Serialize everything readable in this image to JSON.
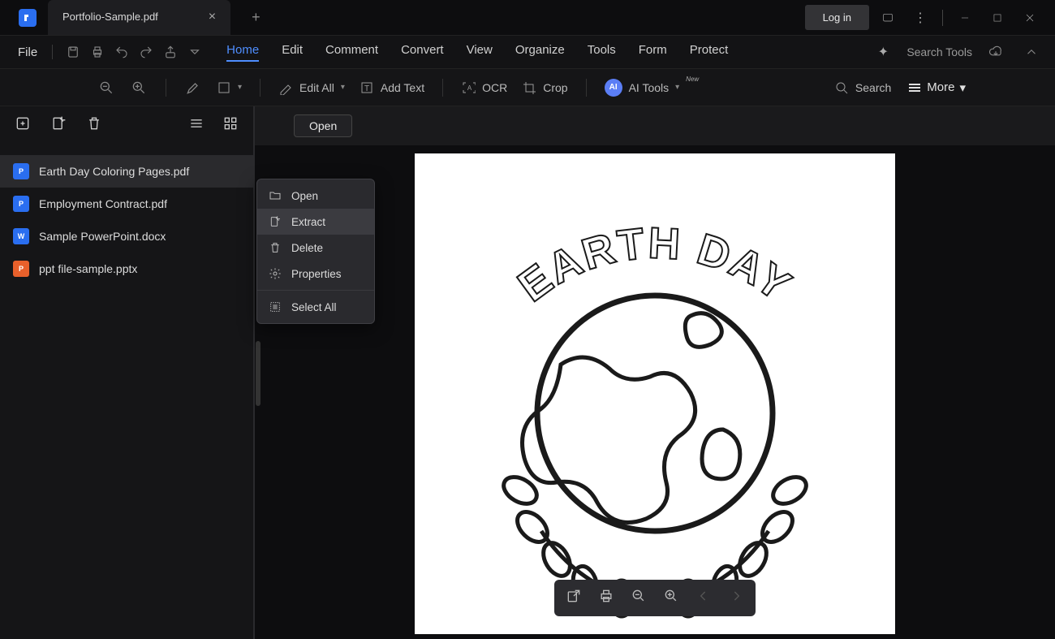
{
  "titlebar": {
    "tab_title": "Portfolio-Sample.pdf",
    "login": "Log in"
  },
  "menu": {
    "file": "File",
    "tabs": [
      "Home",
      "Edit",
      "Comment",
      "Convert",
      "View",
      "Organize",
      "Tools",
      "Form",
      "Protect"
    ],
    "active_index": 0,
    "search_tools": "Search Tools"
  },
  "toolbar": {
    "edit_all": "Edit All",
    "add_text": "Add Text",
    "ocr": "OCR",
    "crop": "Crop",
    "ai_tools": "AI Tools",
    "ai_new": "New",
    "search": "Search",
    "more": "More"
  },
  "sidebar": {
    "files": [
      {
        "name": "Earth Day Coloring Pages.pdf",
        "type": "pdf",
        "selected": true
      },
      {
        "name": "Employment Contract.pdf",
        "type": "pdf",
        "selected": false
      },
      {
        "name": "Sample PowerPoint.docx",
        "type": "word",
        "selected": false
      },
      {
        "name": "ppt file-sample.pptx",
        "type": "ppt",
        "selected": false
      }
    ]
  },
  "open_btn": "Open",
  "context_menu": {
    "items": [
      {
        "label": "Open",
        "icon": "folder"
      },
      {
        "label": "Extract",
        "icon": "extract",
        "highlighted": true
      },
      {
        "label": "Delete",
        "icon": "trash"
      },
      {
        "label": "Properties",
        "icon": "gear"
      }
    ],
    "select_all": "Select All"
  },
  "document": {
    "title": "EARTH DAY"
  }
}
